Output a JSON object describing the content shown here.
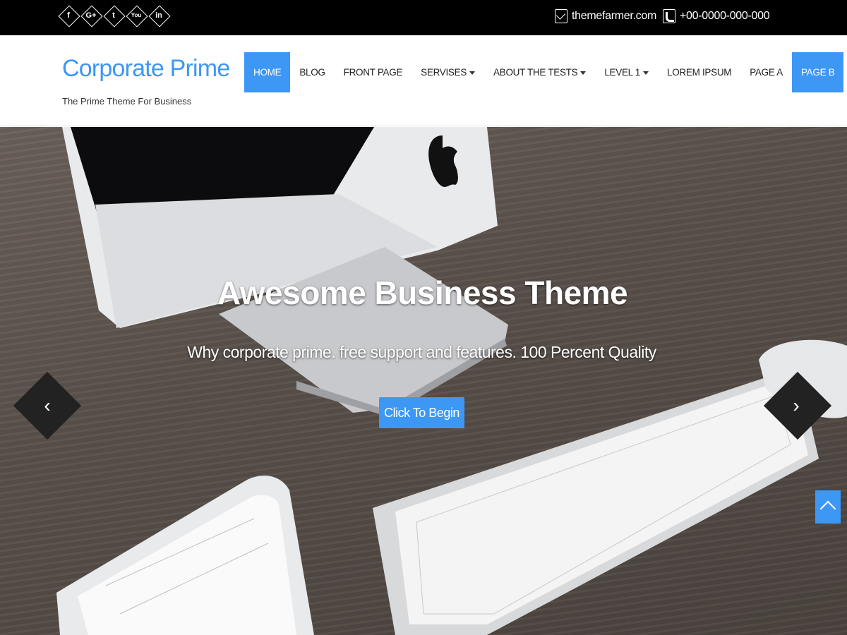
{
  "topbar": {
    "social": [
      {
        "icon": "facebook-icon",
        "glyph": "f"
      },
      {
        "icon": "google-plus-icon",
        "glyph": "G+"
      },
      {
        "icon": "twitter-icon",
        "glyph": "t"
      },
      {
        "icon": "youtube-icon",
        "glyph": "You"
      },
      {
        "icon": "linkedin-icon",
        "glyph": "in"
      }
    ],
    "email": "themefarmer.com",
    "phone": "+00-0000-000-000"
  },
  "header": {
    "site_title": "Corporate Prime",
    "tagline": "The Prime Theme For Business"
  },
  "nav": {
    "items": [
      {
        "label": "HOME",
        "active": true,
        "dropdown": false
      },
      {
        "label": "BLOG",
        "active": false,
        "dropdown": false
      },
      {
        "label": "FRONT PAGE",
        "active": false,
        "dropdown": false
      },
      {
        "label": "SERVISES",
        "active": false,
        "dropdown": true
      },
      {
        "label": "ABOUT THE TESTS",
        "active": false,
        "dropdown": true
      },
      {
        "label": "LEVEL 1",
        "active": false,
        "dropdown": true
      },
      {
        "label": "LOREM IPSUM",
        "active": false,
        "dropdown": false
      },
      {
        "label": "PAGE A",
        "active": false,
        "dropdown": false
      },
      {
        "label": "PAGE B",
        "active": true,
        "dropdown": false
      }
    ]
  },
  "hero": {
    "title": "Awesome Business Theme",
    "subtitle": "Why corporate prime. free support and features. 100 Percent Quality",
    "cta_label": "Click To Begin",
    "prev_glyph": "‹",
    "next_glyph": "›"
  },
  "colors": {
    "accent": "#3d97f5",
    "topbar_bg": "#000000"
  }
}
